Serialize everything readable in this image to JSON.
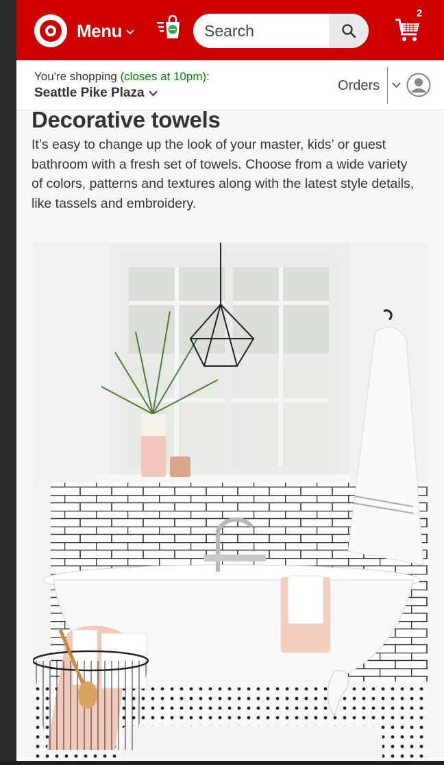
{
  "header": {
    "menu_label": "Menu",
    "search_placeholder": "Search",
    "cart_count": "2",
    "brand_color": "#cc0000"
  },
  "store": {
    "shopping_prefix": "You're shopping ",
    "hours": "(closes at 10pm)",
    "suffix": ":",
    "name": "Seattle Pike Plaza",
    "orders_label": "Orders",
    "hours_color": "#008300"
  },
  "article": {
    "title": "Decorative towels",
    "description": "It’s easy to change up the look of your master, kids’ or guest bathroom with a fresh set of towels. Choose from a wide variety of colors, patterns and textures along with the latest style details, like tassels and embroidery."
  },
  "icons": [
    "target-logo-icon",
    "chevron-down-icon",
    "shopping-bag-icon",
    "search-icon",
    "cart-icon",
    "user-avatar-icon"
  ]
}
